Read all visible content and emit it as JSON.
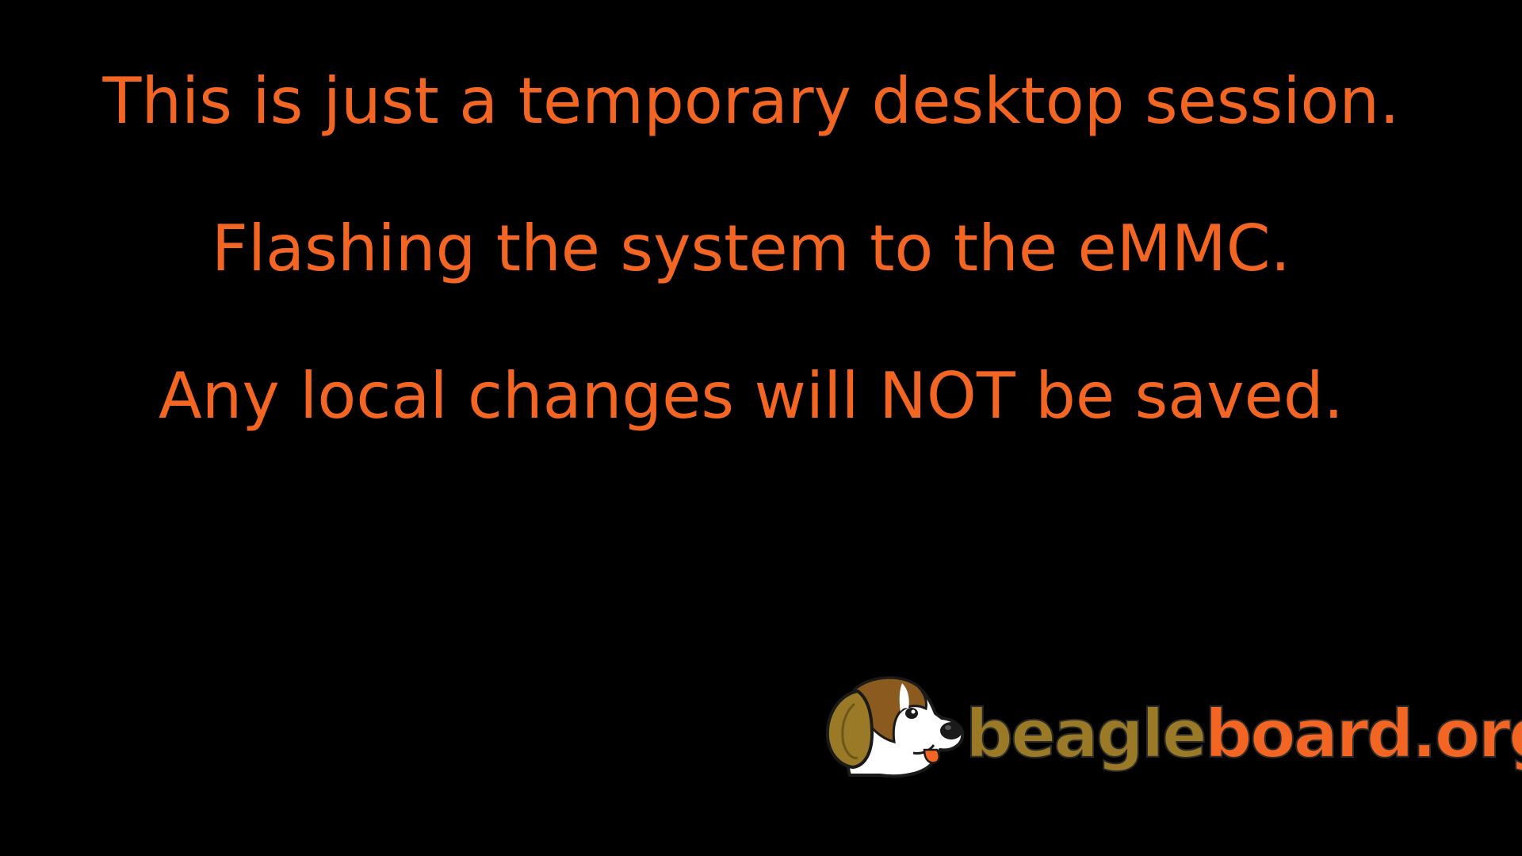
{
  "messages": {
    "line1": "This is just a temporary desktop session.",
    "line2": "Flashing the system to the eMMC.",
    "line3": "Any local changes will NOT be saved."
  },
  "logo": {
    "part1": "beagle",
    "part2": "board.org",
    "mark_icon": "beagle-dog-head-icon"
  },
  "colors": {
    "background": "#000000",
    "message_text": "#f26522",
    "logo_gold": "#9a7a26",
    "logo_orange": "#f26522"
  }
}
